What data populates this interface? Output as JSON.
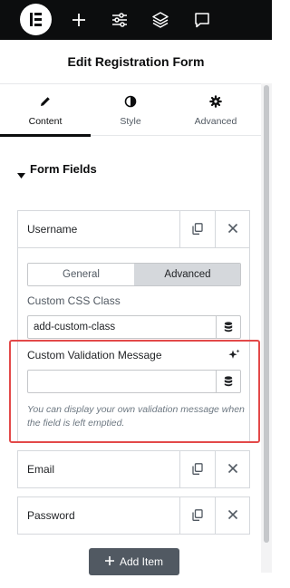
{
  "topbar": {
    "logo_icon": "elementor-logo-icon",
    "icons": [
      "plus-icon",
      "sliders-icon",
      "layers-icon",
      "chat-bubble-icon"
    ]
  },
  "panel": {
    "title": "Edit Registration Form"
  },
  "tabs": [
    {
      "label": "Content",
      "icon": "pencil-icon",
      "active": true
    },
    {
      "label": "Style",
      "icon": "half-circle-icon",
      "active": false
    },
    {
      "label": "Advanced",
      "icon": "gear-icon",
      "active": false
    }
  ],
  "section": {
    "title": "Form Fields",
    "expanded": true
  },
  "fields": {
    "username": {
      "label": "Username"
    },
    "email": {
      "label": "Email"
    },
    "password": {
      "label": "Password"
    }
  },
  "editor": {
    "segments": {
      "general": "General",
      "advanced": "Advanced",
      "active": "Advanced"
    },
    "css_class": {
      "label": "Custom CSS Class",
      "value": "add-custom-class"
    },
    "validation": {
      "label": "Custom Validation Message",
      "value": "",
      "hint": "You can display your own validation message when the field is left emptied."
    }
  },
  "add_item": {
    "label": "Add Item"
  },
  "colors": {
    "accent": "#e34949",
    "topbar": "#0c0d0e",
    "button": "#515962"
  }
}
